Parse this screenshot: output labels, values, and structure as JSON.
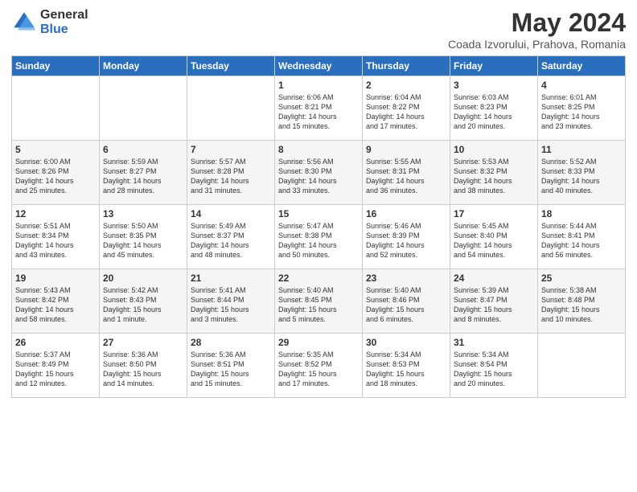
{
  "header": {
    "logo_general": "General",
    "logo_blue": "Blue",
    "title": "May 2024",
    "subtitle": "Coada Izvorului, Prahova, Romania"
  },
  "days_of_week": [
    "Sunday",
    "Monday",
    "Tuesday",
    "Wednesday",
    "Thursday",
    "Friday",
    "Saturday"
  ],
  "weeks": [
    [
      {
        "day": "",
        "content": ""
      },
      {
        "day": "",
        "content": ""
      },
      {
        "day": "",
        "content": ""
      },
      {
        "day": "1",
        "content": "Sunrise: 6:06 AM\nSunset: 8:21 PM\nDaylight: 14 hours\nand 15 minutes."
      },
      {
        "day": "2",
        "content": "Sunrise: 6:04 AM\nSunset: 8:22 PM\nDaylight: 14 hours\nand 17 minutes."
      },
      {
        "day": "3",
        "content": "Sunrise: 6:03 AM\nSunset: 8:23 PM\nDaylight: 14 hours\nand 20 minutes."
      },
      {
        "day": "4",
        "content": "Sunrise: 6:01 AM\nSunset: 8:25 PM\nDaylight: 14 hours\nand 23 minutes."
      }
    ],
    [
      {
        "day": "5",
        "content": "Sunrise: 6:00 AM\nSunset: 8:26 PM\nDaylight: 14 hours\nand 25 minutes."
      },
      {
        "day": "6",
        "content": "Sunrise: 5:59 AM\nSunset: 8:27 PM\nDaylight: 14 hours\nand 28 minutes."
      },
      {
        "day": "7",
        "content": "Sunrise: 5:57 AM\nSunset: 8:28 PM\nDaylight: 14 hours\nand 31 minutes."
      },
      {
        "day": "8",
        "content": "Sunrise: 5:56 AM\nSunset: 8:30 PM\nDaylight: 14 hours\nand 33 minutes."
      },
      {
        "day": "9",
        "content": "Sunrise: 5:55 AM\nSunset: 8:31 PM\nDaylight: 14 hours\nand 36 minutes."
      },
      {
        "day": "10",
        "content": "Sunrise: 5:53 AM\nSunset: 8:32 PM\nDaylight: 14 hours\nand 38 minutes."
      },
      {
        "day": "11",
        "content": "Sunrise: 5:52 AM\nSunset: 8:33 PM\nDaylight: 14 hours\nand 40 minutes."
      }
    ],
    [
      {
        "day": "12",
        "content": "Sunrise: 5:51 AM\nSunset: 8:34 PM\nDaylight: 14 hours\nand 43 minutes."
      },
      {
        "day": "13",
        "content": "Sunrise: 5:50 AM\nSunset: 8:35 PM\nDaylight: 14 hours\nand 45 minutes."
      },
      {
        "day": "14",
        "content": "Sunrise: 5:49 AM\nSunset: 8:37 PM\nDaylight: 14 hours\nand 48 minutes."
      },
      {
        "day": "15",
        "content": "Sunrise: 5:47 AM\nSunset: 8:38 PM\nDaylight: 14 hours\nand 50 minutes."
      },
      {
        "day": "16",
        "content": "Sunrise: 5:46 AM\nSunset: 8:39 PM\nDaylight: 14 hours\nand 52 minutes."
      },
      {
        "day": "17",
        "content": "Sunrise: 5:45 AM\nSunset: 8:40 PM\nDaylight: 14 hours\nand 54 minutes."
      },
      {
        "day": "18",
        "content": "Sunrise: 5:44 AM\nSunset: 8:41 PM\nDaylight: 14 hours\nand 56 minutes."
      }
    ],
    [
      {
        "day": "19",
        "content": "Sunrise: 5:43 AM\nSunset: 8:42 PM\nDaylight: 14 hours\nand 58 minutes."
      },
      {
        "day": "20",
        "content": "Sunrise: 5:42 AM\nSunset: 8:43 PM\nDaylight: 15 hours\nand 1 minute."
      },
      {
        "day": "21",
        "content": "Sunrise: 5:41 AM\nSunset: 8:44 PM\nDaylight: 15 hours\nand 3 minutes."
      },
      {
        "day": "22",
        "content": "Sunrise: 5:40 AM\nSunset: 8:45 PM\nDaylight: 15 hours\nand 5 minutes."
      },
      {
        "day": "23",
        "content": "Sunrise: 5:40 AM\nSunset: 8:46 PM\nDaylight: 15 hours\nand 6 minutes."
      },
      {
        "day": "24",
        "content": "Sunrise: 5:39 AM\nSunset: 8:47 PM\nDaylight: 15 hours\nand 8 minutes."
      },
      {
        "day": "25",
        "content": "Sunrise: 5:38 AM\nSunset: 8:48 PM\nDaylight: 15 hours\nand 10 minutes."
      }
    ],
    [
      {
        "day": "26",
        "content": "Sunrise: 5:37 AM\nSunset: 8:49 PM\nDaylight: 15 hours\nand 12 minutes."
      },
      {
        "day": "27",
        "content": "Sunrise: 5:36 AM\nSunset: 8:50 PM\nDaylight: 15 hours\nand 14 minutes."
      },
      {
        "day": "28",
        "content": "Sunrise: 5:36 AM\nSunset: 8:51 PM\nDaylight: 15 hours\nand 15 minutes."
      },
      {
        "day": "29",
        "content": "Sunrise: 5:35 AM\nSunset: 8:52 PM\nDaylight: 15 hours\nand 17 minutes."
      },
      {
        "day": "30",
        "content": "Sunrise: 5:34 AM\nSunset: 8:53 PM\nDaylight: 15 hours\nand 18 minutes."
      },
      {
        "day": "31",
        "content": "Sunrise: 5:34 AM\nSunset: 8:54 PM\nDaylight: 15 hours\nand 20 minutes."
      },
      {
        "day": "",
        "content": ""
      }
    ]
  ]
}
